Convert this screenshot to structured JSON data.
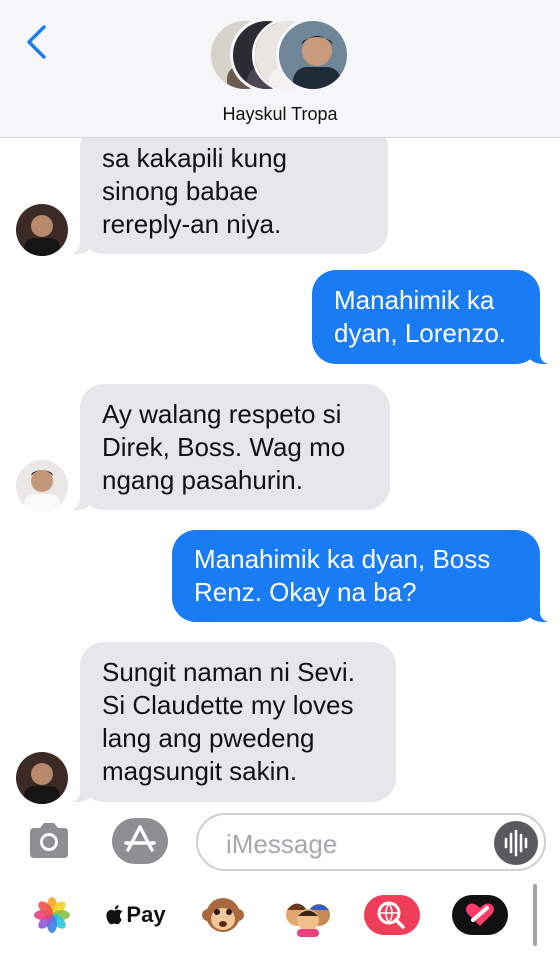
{
  "header": {
    "group_name": "Hayskul Tropa",
    "back_icon": "chevron-left-icon",
    "accent": "#1a7cf5"
  },
  "messages": [
    {
      "direction": "incoming",
      "text": "sa kakapili kung\nsinong babae\nrereply-an niya."
    },
    {
      "direction": "outgoing",
      "text": "Manahimik ka\ndyan, Lorenzo."
    },
    {
      "direction": "incoming",
      "text": "Ay walang respeto si\nDirek, Boss. Wag mo\nngang pasahurin."
    },
    {
      "direction": "outgoing",
      "text": "Manahimik ka dyan, Boss\nRenz. Okay na ba?"
    },
    {
      "direction": "incoming",
      "text": "Sungit naman ni Sevi.\nSi Claudette my loves\nlang ang pwedeng\nmagsungit sakin."
    }
  ],
  "input": {
    "placeholder": "iMessage",
    "camera_icon": "camera-icon",
    "apps_icon": "app-store-icon",
    "audio_icon": "audio-waveform-icon"
  },
  "drawer": {
    "apple_pay_label": "Pay",
    "apps": [
      "photos-icon",
      "apple-pay-icon",
      "monkey-animoji-icon",
      "memoji-icon",
      "web-search-icon",
      "digital-touch-icon"
    ]
  },
  "colors": {
    "incoming_bubble": "#e6e6eb",
    "outgoing_bubble": "#1a7cf5"
  }
}
